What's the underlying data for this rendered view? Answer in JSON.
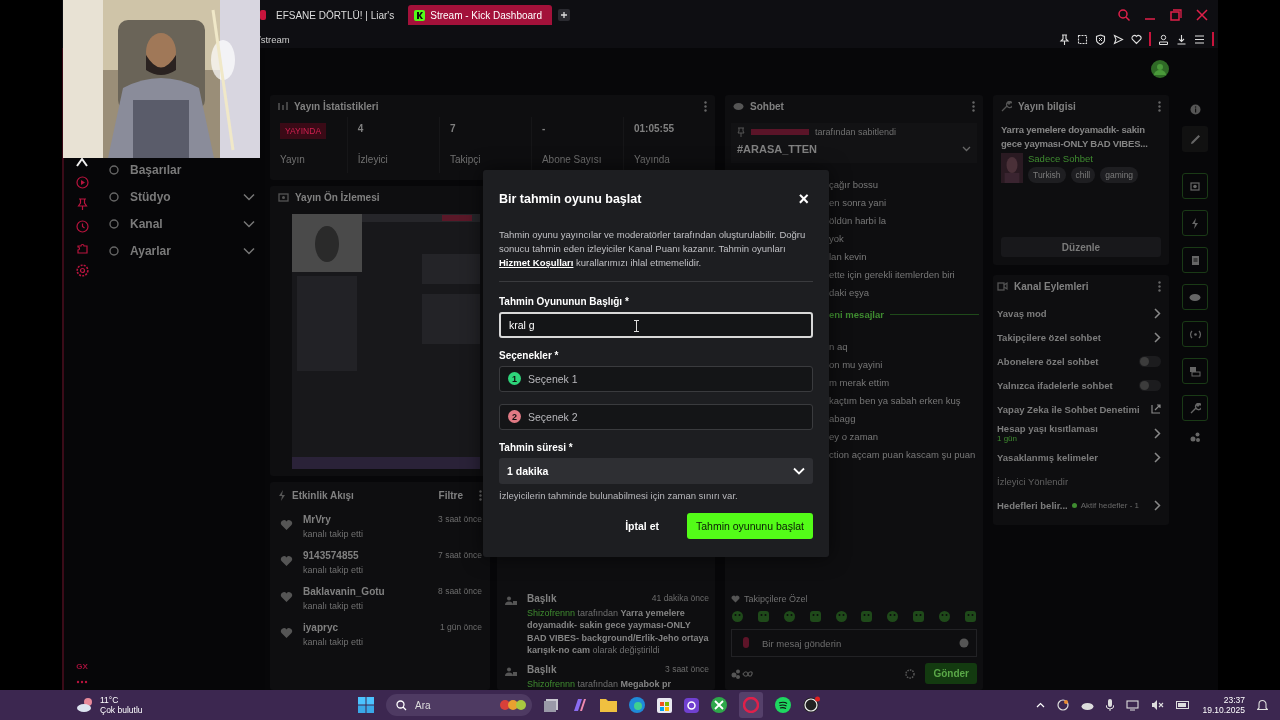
{
  "browser": {
    "tabs": [
      {
        "title": "EFSANE DÖRTLÜ! | Liar's",
        "selected": false
      },
      {
        "title": "Stream - Kick Dashboard",
        "selected": true
      }
    ],
    "address": "/stream"
  },
  "rail": {
    "brand": "GX"
  },
  "sidebar": {
    "items": [
      {
        "label": "Başarılar",
        "expandable": false
      },
      {
        "label": "Stüdyo",
        "expandable": true
      },
      {
        "label": "Kanal",
        "expandable": true
      },
      {
        "label": "Ayarlar",
        "expandable": true
      }
    ]
  },
  "stats": {
    "title": "Yayın İstatistikleri",
    "live_badge": "YAYINDA",
    "live_label": "Yayın",
    "items": [
      {
        "value": "4",
        "label": "İzleyici"
      },
      {
        "value": "7",
        "label": "Takipçi"
      },
      {
        "value": "-",
        "label": "Abone Sayısı"
      },
      {
        "value": "01:05:55",
        "label": "Yayında"
      }
    ]
  },
  "preview": {
    "title": "Yayın Ön İzlemesi"
  },
  "activity": {
    "title": "Etkinlik Akışı",
    "filter": "Filtre",
    "events": [
      {
        "user": "MrVry",
        "action": "kanalı takip etti",
        "time": "3 saat önce"
      },
      {
        "user": "9143574855",
        "action": "kanalı takip etti",
        "time": "7 saat önce"
      },
      {
        "user": "Baklavanin_Gotu",
        "action": "kanalı takip etti",
        "time": "8 saat önce"
      },
      {
        "user": "iyapryc",
        "action": "kanalı takip etti",
        "time": "1 gün önce"
      }
    ]
  },
  "history": {
    "entries": [
      {
        "title": "Başlık",
        "time": "41 dakika önce",
        "user": "Shizofrennn",
        "text": "tarafından **Yarra yemelere doyamadık- sakin gece yayması-ONLY BAD VIBES- background/Erlik-Jeho ortaya karışık-no cam** olarak değiştirildi"
      },
      {
        "title": "Başlık",
        "time": "3 saat önce",
        "user": "Shizofrennn",
        "text": "tarafından **Megabok pr**"
      }
    ]
  },
  "chat": {
    "title": "Sohbet",
    "pinned_by": "tarafından sabitlendi",
    "pinned_text": "#ARASA_TTEN",
    "messages": [
      {
        "kind": "message",
        "text": "çağır bossu"
      },
      {
        "kind": "message",
        "text": "en sonra yani"
      },
      {
        "kind": "message",
        "text": "öldün harbi la"
      },
      {
        "kind": "message",
        "text": "yok"
      },
      {
        "kind": "message",
        "text": "lan kevin"
      },
      {
        "kind": "message",
        "text": "ette için gerekli itemlerden biri"
      },
      {
        "kind": "message",
        "text": "daki eşya"
      },
      {
        "kind": "divider",
        "text": "eni mesajlar"
      },
      {
        "kind": "message",
        "text": "n aq"
      },
      {
        "kind": "message",
        "text": "on mu yayini"
      },
      {
        "kind": "message",
        "text": "m merak ettim"
      },
      {
        "kind": "message",
        "text": "kaçtım ben ya sabah erken kuş"
      },
      {
        "kind": "message",
        "text": "abagg"
      },
      {
        "kind": "message",
        "text": "ey o zaman"
      },
      {
        "kind": "message",
        "text": "ction açcam puan kascam şu puan"
      }
    ],
    "mode": "Takipçilere Özel",
    "placeholder": "Bir mesaj gönderin",
    "send": "Gönder"
  },
  "info": {
    "title": "Yayın bilgisi",
    "stream_title": "Yarra yemelere doyamadık- sakin gece yayması-ONLY BAD VIBES...",
    "category": "Sadece Sohbet",
    "tags": [
      "Turkish",
      "chill",
      "gaming"
    ],
    "edit": "Düzenle"
  },
  "actions": {
    "title": "Kanal Eylemleri",
    "items": [
      {
        "kind": "link",
        "label": "Yavaş mod"
      },
      {
        "kind": "link",
        "label": "Takipçilere özel sohbet"
      },
      {
        "kind": "toggle",
        "label": "Abonelere özel sohbet",
        "on": false
      },
      {
        "kind": "toggle",
        "label": "Yalnızca ifadelerle sohbet",
        "on": false
      },
      {
        "kind": "external",
        "label": "Yapay Zeka ile Sohbet Denetimi"
      },
      {
        "kind": "link",
        "label": "Hesap yaşı kısıtlaması",
        "sub": "1 gün"
      },
      {
        "kind": "link",
        "label": "Yasaklanmış kelimeler"
      },
      {
        "kind": "heading",
        "label": "İzleyici Yönlendir"
      },
      {
        "kind": "goal",
        "label": "Hedefleri belir...",
        "status": "Aktif hedefler - 1"
      }
    ]
  },
  "modal": {
    "title": "Bir tahmin oyunu başlat",
    "close": "×",
    "description_before": "Tahmin oyunu yayıncılar ve moderatörler tarafından oluşturulabilir. Doğru sonucu tahmin eden izleyiciler Kanal Puanı kazanır. Tahmin oyunları",
    "link": "Hizmet Koşulları",
    "description_after": "kurallarımızı ihlal etmemelidir.",
    "title_label": "Tahmin Oyununun Başlığı *",
    "title_value": "kral g",
    "options_label": "Seçenekler *",
    "options": [
      {
        "number": "1",
        "placeholder": "Seçenek 1",
        "color": "#2ed47a"
      },
      {
        "number": "2",
        "placeholder": "Seçenek 2",
        "color": "#e07a84"
      }
    ],
    "duration_label": "Tahmin süresi *",
    "duration": "1 dakika",
    "hint": "İzleyicilerin tahminde bulunabilmesi için zaman sınırı var.",
    "cancel": "İptal et",
    "submit": "Tahmin oyununu başlat"
  },
  "taskbar": {
    "temperature": "11°C",
    "weather": "Çok bulutlu",
    "search": "Ara",
    "time": "23:37",
    "date": "19.10.2025"
  }
}
